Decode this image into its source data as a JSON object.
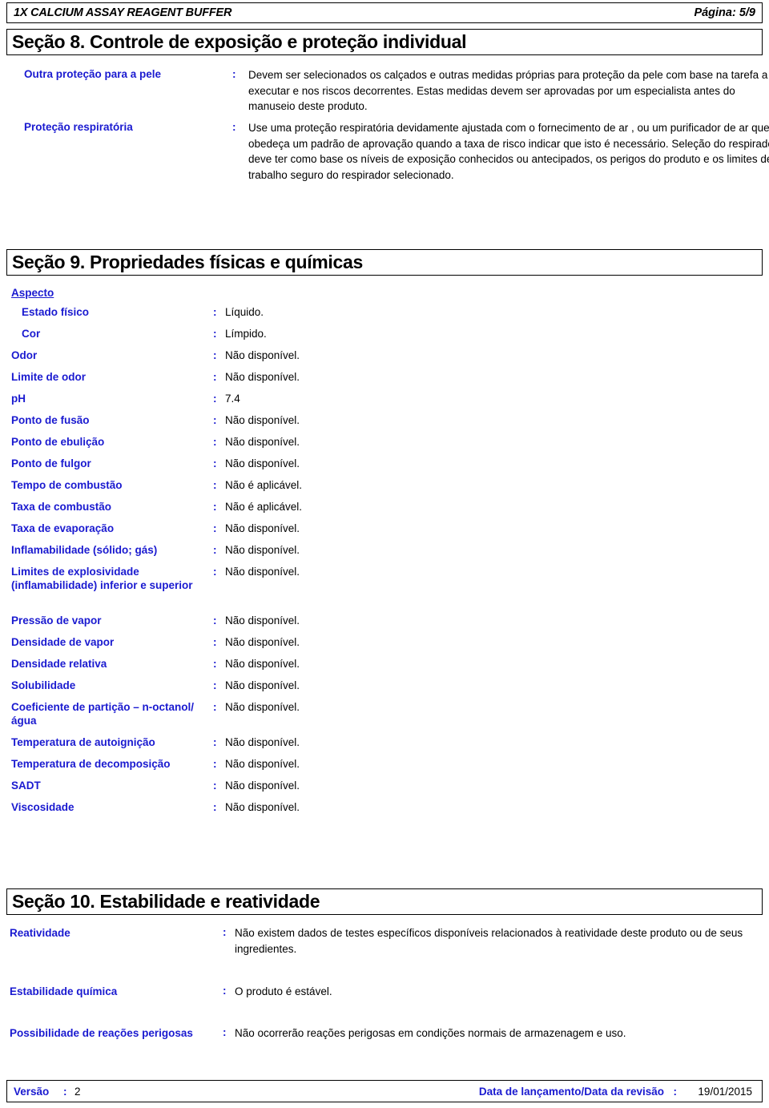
{
  "header": {
    "product_title": "1X CALCIUM ASSAY REAGENT BUFFER",
    "page_indicator": "Página: 5/9"
  },
  "section8": {
    "title": "Seção 8. Controle de exposição e proteção individual",
    "colon": ":",
    "rows": [
      {
        "label": "Outra proteção para a pele",
        "value": "Devem ser selecionados os calçados e outras medidas próprias para proteção da pele com base na tarefa a executar e nos riscos decorrentes. Estas medidas devem ser aprovadas por um especialista antes do manuseio deste produto."
      },
      {
        "label": "Proteção respiratória",
        "value": "Use uma proteção respiratória devidamente ajustada com o fornecimento de ar , ou um purificador de ar que obedeça um padrão de aprovação quando a taxa de risco indicar que isto é necessário.  Seleção do respirador deve ter como base os níveis de exposição conhecidos ou antecipados, os perigos do produto e os limites de trabalho seguro do respirador selecionado."
      }
    ]
  },
  "section9": {
    "title": "Seção 9. Propriedades físicas e químicas",
    "group_heading": "Aspecto",
    "colon": ":",
    "properties": [
      {
        "label": "Estado físico",
        "value": "Líquido.",
        "indent": true
      },
      {
        "label": "Cor",
        "value": "Límpido.",
        "indent": true
      },
      {
        "label": "Odor",
        "value": "Não disponível.",
        "indent": false
      },
      {
        "label": "Limite de odor",
        "value": "Não disponível.",
        "indent": false
      },
      {
        "label": "pH",
        "value": "7.4",
        "indent": false
      },
      {
        "label": "Ponto de fusão",
        "value": "Não disponível.",
        "indent": false
      },
      {
        "label": "Ponto de ebulição",
        "value": "Não disponível.",
        "indent": false
      },
      {
        "label": "Ponto de fulgor",
        "value": "Não disponível.",
        "indent": false
      },
      {
        "label": "Tempo de combustão",
        "value": "Não é aplicável.",
        "indent": false
      },
      {
        "label": "Taxa de combustão",
        "value": "Não é aplicável.",
        "indent": false
      },
      {
        "label": "Taxa de evaporação",
        "value": "Não disponível.",
        "indent": false
      },
      {
        "label": "Inflamabilidade (sólido; gás)",
        "value": "Não disponível.",
        "indent": false
      },
      {
        "label": "Limites de explosividade (inflamabilidade) inferior e superior",
        "value": "Não disponível.",
        "indent": false
      },
      {
        "label": "Pressão de vapor",
        "value": "Não disponível.",
        "indent": false
      },
      {
        "label": "Densidade de vapor",
        "value": "Não disponível.",
        "indent": false
      },
      {
        "label": "Densidade relativa",
        "value": "Não disponível.",
        "indent": false
      },
      {
        "label": "Solubilidade",
        "value": "Não disponível.",
        "indent": false
      },
      {
        "label": "Coeficiente de partição – n-octanol/água",
        "value": "Não disponível.",
        "indent": false
      },
      {
        "label": "Temperatura de autoignição",
        "value": "Não disponível.",
        "indent": false
      },
      {
        "label": "Temperatura de decomposição",
        "value": "Não disponível.",
        "indent": false
      },
      {
        "label": "SADT",
        "value": "Não disponível.",
        "indent": false
      },
      {
        "label": "Viscosidade",
        "value": "Não disponível.",
        "indent": false
      }
    ]
  },
  "section10": {
    "title": "Seção 10. Estabilidade e reatividade",
    "colon": ":",
    "rows": [
      {
        "label": "Reatividade",
        "value": "Não existem dados de testes específicos disponíveis relacionados à reatividade deste produto ou de seus ingredientes."
      },
      {
        "label": "Estabilidade química",
        "value": "O produto é estável."
      },
      {
        "label": "Possibilidade de reações perigosas",
        "value": "Não ocorrerão reações perigosas em condições normais de armazenagem e uso."
      }
    ]
  },
  "footer": {
    "version_label": "Versão",
    "version_colon": ":",
    "version_value": "2",
    "date_label": "Data de lançamento/Data da revisão",
    "date_colon": ":",
    "date_value": "19/01/2015"
  },
  "colors": {
    "label_blue": "#1a1ad0",
    "text_black": "#000000",
    "border": "#000000",
    "background": "#ffffff"
  }
}
